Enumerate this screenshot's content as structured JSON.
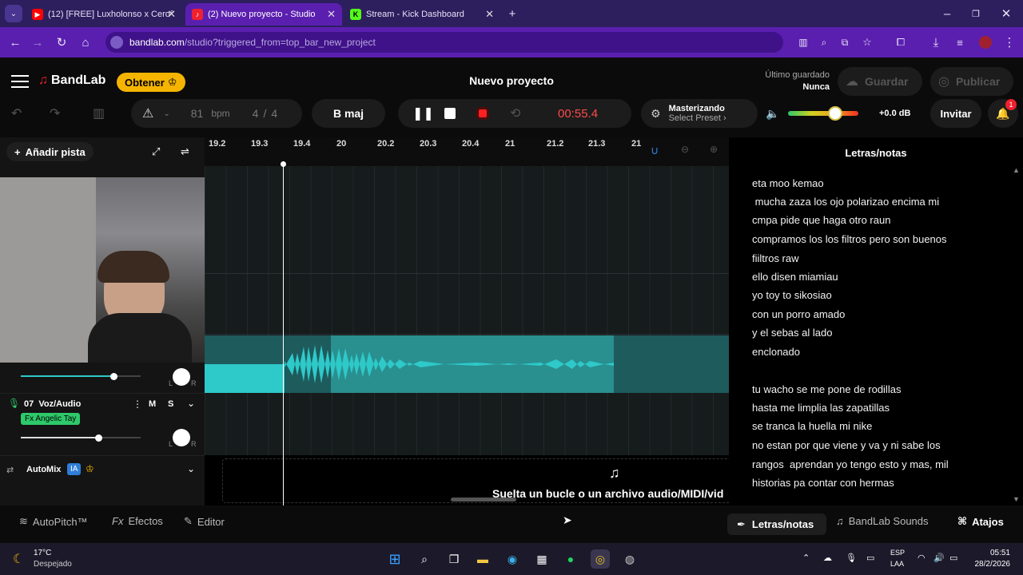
{
  "browser": {
    "tabs": [
      {
        "label": "(12) [FREE] Luxholonso x Cero°",
        "favicon": "youtube-icon"
      },
      {
        "label": "(2) Nuevo proyecto - Studio",
        "favicon": "bandlab-icon"
      },
      {
        "label": "Stream - Kick Dashboard",
        "favicon": "kick-icon"
      }
    ],
    "url_domain": "bandlab.com",
    "url_path": "/studio?triggered_from=top_bar_new_project"
  },
  "header": {
    "brand": "BandLab",
    "obtener_label": "Obtener",
    "project_title": "Nuevo proyecto",
    "last_saved_label": "Último guardado",
    "last_saved_value": "Nunca",
    "save_label": "Guardar",
    "publish_label": "Publicar"
  },
  "transport": {
    "bpm_value": "81",
    "bpm_unit": "bpm",
    "time_sig_num": "4",
    "time_sig_den": "4",
    "key": "B maj",
    "time": "00:55.4",
    "mastering_label": "Masterizando",
    "preset_label": "Select Preset",
    "volume_db": "+0.0 dB",
    "invite_label": "Invitar",
    "notif_count": "1"
  },
  "tracks_panel": {
    "add_track_label": "Añadir pista",
    "track7_name": "07  Voz/Audio",
    "track7_fx": "Fx Angelic Tay",
    "mute": "M",
    "solo": "S",
    "pan_l": "L",
    "pan_r": "R",
    "automix_label": "AutoMix",
    "automix_badge": "IA"
  },
  "ruler": {
    "ticks": [
      "19.2",
      "19.3",
      "19.4",
      "20",
      "20.2",
      "20.3",
      "20.4",
      "21",
      "21.2",
      "21.3",
      "21"
    ]
  },
  "drop_zone_text": "Suelta un bucle o un archivo audio/MIDI/vid",
  "lyrics": {
    "title": "Letras/notas",
    "lines": [
      "eta moo kemao",
      " mucha zaza los ojo polarizao encima mi",
      "cmpa pide que haga otro raun",
      "compramos los los filtros pero son buenos",
      "fiiltros raw",
      "ello disen miamiau",
      "yo toy to sikosiao",
      "con un porro amado",
      "y el sebas al lado",
      "enclonado",
      "",
      "tu wacho se me pone de rodillas",
      "hasta me limplia las zapatillas",
      "se tranca la huella mi nike",
      "no estan por que viene y va y ni sabe los",
      "rangos  aprendan yo tengo esto y mas, mil",
      "historias pa contar con hermas"
    ]
  },
  "bottom": {
    "autopitch": "AutoPitch™",
    "effects": "Efectos",
    "editor": "Editor",
    "lyrics_tab": "Letras/notas",
    "sounds_tab": "BandLab Sounds",
    "shortcuts": "Atajos"
  },
  "taskbar": {
    "weather_temp": "17°C",
    "weather_desc": "Despejado",
    "lang1": "ESP",
    "lang2": "LAA",
    "time": "05:51",
    "date": "28/2/2026"
  },
  "colors": {
    "accent_purple": "#5b1fb0",
    "bandlab_red": "#f0202e",
    "waveform_teal": "#2ec9c9",
    "obtener_yellow": "#f5b400",
    "time_red": "#ff4a4a"
  }
}
